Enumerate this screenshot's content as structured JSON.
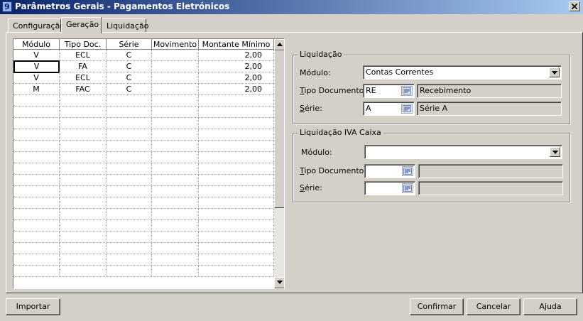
{
  "window": {
    "title": "Parâmetros Gerais - Pagamentos Eletrónicos"
  },
  "tabs": [
    {
      "label": "Configuração",
      "active": false
    },
    {
      "label": "Geração",
      "active": true
    },
    {
      "label": "Liquidação",
      "active": false
    }
  ],
  "grid": {
    "columns": [
      "Módulo",
      "Tipo Doc.",
      "Série",
      "Movimento",
      "Montante Mínimo"
    ],
    "rows": [
      {
        "modulo": "V",
        "tipo": "ECL",
        "serie": "C",
        "movimento": "",
        "montante": "2,00"
      },
      {
        "modulo": "V",
        "tipo": "FA",
        "serie": "C",
        "movimento": "",
        "montante": "2,00"
      },
      {
        "modulo": "V",
        "tipo": "ECL",
        "serie": "C",
        "movimento": "",
        "montante": "2,00"
      },
      {
        "modulo": "M",
        "tipo": "FAC",
        "serie": "C",
        "movimento": "",
        "montante": "2,00"
      },
      {},
      {},
      {},
      {},
      {},
      {},
      {},
      {},
      {},
      {},
      {},
      {},
      {},
      {},
      {},
      {}
    ]
  },
  "liquidacao": {
    "title": "Liquidação",
    "modulo_label": "Módulo:",
    "modulo_value": "Contas Correntes",
    "tipo_label_first": "T",
    "tipo_label_rest": "ipo Documento:",
    "tipo_value": "RE",
    "tipo_desc": "Recebimento",
    "serie_label_first": "S",
    "serie_label_rest": "érie:",
    "serie_value": "A",
    "serie_desc": "Série A"
  },
  "iva_caixa": {
    "title": "Liquidação IVA Caixa",
    "modulo_label": "Módulo:",
    "modulo_value": "",
    "tipo_label_first": "T",
    "tipo_label_rest": "ipo Documento:",
    "tipo_value": "",
    "tipo_desc": "",
    "serie_label_first": "S",
    "serie_label_rest": "érie:",
    "serie_value": "",
    "serie_desc": ""
  },
  "buttons": {
    "importar": "Importar",
    "confirmar": "Confirmar",
    "cancelar": "Cancelar",
    "ajuda": "Ajuda"
  },
  "icons": {
    "app": "app-icon",
    "close": "close-icon",
    "lookup": "lookup-icon",
    "dropdown": "chevron-down-icon"
  }
}
